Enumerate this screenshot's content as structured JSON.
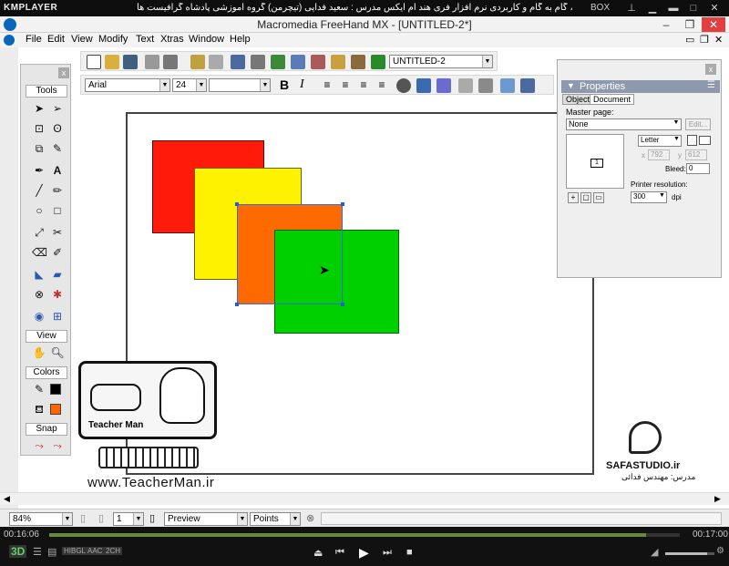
{
  "player": {
    "logo": "KMPLAYER",
    "title": "مجموعه آموزشی جامع ، گام به گام و کاربردی نرم افزار فری هند ام ایکس   مدرس : سعید فدایی (تیچرمن) گروه آموزشی پادشاه گرافیست ها",
    "box_label": "BOX",
    "time_current": "00:16:06",
    "time_total": "00:17:00",
    "badges": [
      "HIBGL",
      "AAC",
      "2CH"
    ],
    "mode_label": "3D"
  },
  "app": {
    "title": "Macromedia FreeHand MX - [UNTITLED-2*]",
    "menu": [
      "File",
      "Edit",
      "View",
      "Modify",
      "Text",
      "Xtras",
      "Window",
      "Help"
    ]
  },
  "toolbar": {
    "document_name": "UNTITLED-2",
    "font_name": "Arial",
    "font_size": "24",
    "bold_label": "B",
    "italic_label": "I"
  },
  "tools_panel": {
    "title": "Tools",
    "view_label": "View",
    "colors_label": "Colors",
    "snap_label": "Snap",
    "stroke_color": "#000000",
    "fill_color": "#ff6600"
  },
  "canvas": {
    "shapes": [
      {
        "name": "red-rectangle",
        "color": "#ff1a0a"
      },
      {
        "name": "yellow-rectangle",
        "color": "#fff200"
      },
      {
        "name": "orange-rectangle",
        "color": "#ff6a00"
      },
      {
        "name": "green-rectangle",
        "color": "#00d000"
      }
    ]
  },
  "properties": {
    "title": "Properties",
    "tabs": [
      "Object",
      "Document"
    ],
    "master_page_label": "Master page:",
    "master_page_value": "None",
    "edit_label": "Edit...",
    "page_size": "Letter",
    "width_label": "x",
    "width_value": "792",
    "height_label": "y",
    "height_value": "612",
    "bleed_label": "Bleed:",
    "bleed_value": "0",
    "page_number": "1",
    "printer_res_label": "Printer resolution:",
    "printer_res_value": "300",
    "dpi_label": "dpi"
  },
  "status": {
    "zoom": "84%",
    "page": "1",
    "display_mode": "Preview",
    "units": "Points"
  },
  "watermark": {
    "url": "www.TeacherMan.ir",
    "logo_text": "Teacher Man",
    "studio": "SAFASTUDIO.ir",
    "studio_credit": "مدرس: مهندس فدائی"
  }
}
